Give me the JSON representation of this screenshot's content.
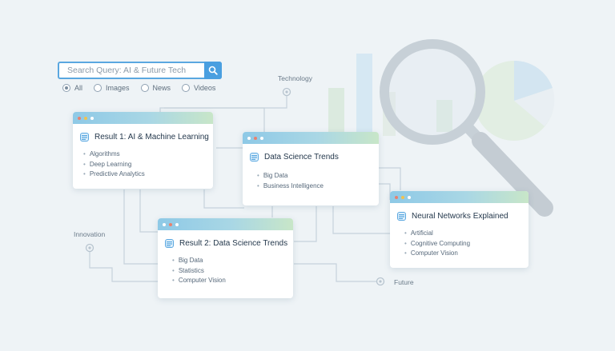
{
  "search": {
    "placeholder": "Search Query: AI & Future Tech",
    "button_icon": "search-icon",
    "filters": [
      {
        "label": "All",
        "selected": true
      },
      {
        "label": "Images",
        "selected": false
      },
      {
        "label": "News",
        "selected": false
      },
      {
        "label": "Videos",
        "selected": false
      }
    ]
  },
  "nodes": {
    "technology": "Technology",
    "innovation": "Innovation",
    "future": "Future"
  },
  "cards": [
    {
      "title": "Result 1: AI & Machine Learning",
      "items": [
        "Algorithms",
        "Deep Learning",
        "Predictive Analytics"
      ]
    },
    {
      "title": "Data Science Trends",
      "items": [
        "Big Data",
        "Business Intelligence"
      ]
    },
    {
      "title": "Neural Networks Explained",
      "items": [
        "Artificial",
        "Cognitive Computing",
        "Computer Vision"
      ]
    },
    {
      "title": "Result 2: Data Science Trends",
      "items": [
        "Big Data",
        "Statistics",
        "Computer Vision"
      ]
    }
  ],
  "colors": {
    "accent": "#4a9fe0",
    "background": "#eef3f6",
    "dot_red": "#e8806e",
    "dot_yellow": "#f2c14e",
    "dot_green": "#9dc9a8"
  }
}
